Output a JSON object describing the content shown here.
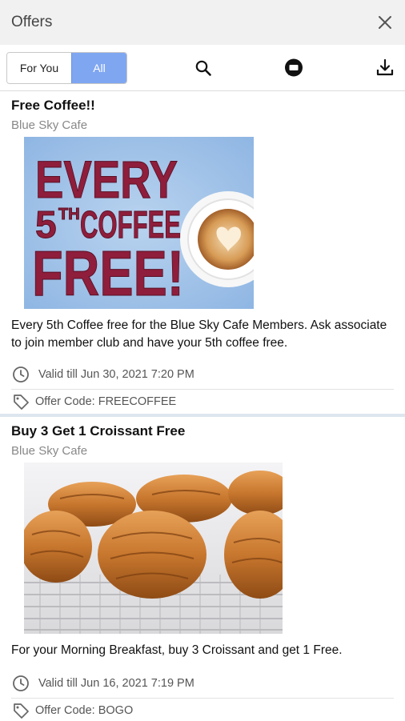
{
  "header": {
    "title": "Offers",
    "close_icon": "close-icon"
  },
  "toolbar": {
    "tabs": [
      {
        "label": "For You",
        "selected": false
      },
      {
        "label": "All",
        "selected": true
      }
    ],
    "icons": [
      "search-icon",
      "chat-bubble-icon",
      "download-icon"
    ],
    "accent_color": "#7fa6f1"
  },
  "offers": [
    {
      "title": "Free Coffee!!",
      "vendor": "Blue Sky Cafe",
      "image": {
        "line1": "EVERY",
        "line2_num": "5",
        "line2_sup": "TH",
        "line2_rest": "COFFEE",
        "line3": "FREE!"
      },
      "description": "Every 5th Coffee free for the Blue Sky Cafe Members. Ask associate to join member club and have your 5th coffee free.",
      "valid": "Valid till Jun 30, 2021 7:20 PM",
      "code": "Offer Code: FREECOFFEE"
    },
    {
      "title": "Buy 3 Get 1 Croissant Free",
      "vendor": "Blue Sky Cafe",
      "description": "For your Morning Breakfast, buy 3 Croissant and get 1 Free.",
      "valid": "Valid till Jun 16, 2021 7:19 PM",
      "code": "Offer Code: BOGO"
    }
  ]
}
